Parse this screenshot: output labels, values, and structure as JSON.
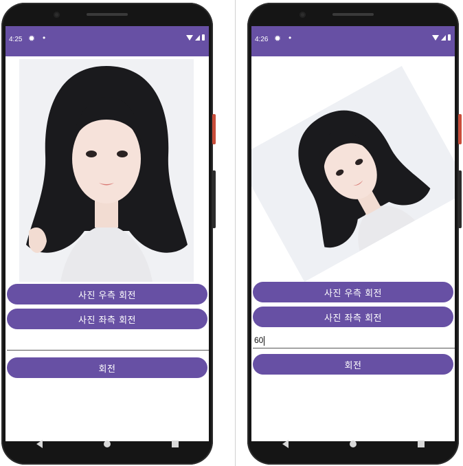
{
  "left_phone": {
    "status_time": "4:25",
    "buttons": {
      "rotate_right": "사진 우측 회전",
      "rotate_left": "사진 좌측 회전",
      "rotate": "회전"
    },
    "angle_input_value": ""
  },
  "right_phone": {
    "status_time": "4:26",
    "buttons": {
      "rotate_right": "사진 우측 회전",
      "rotate_left": "사진 좌측 회전",
      "rotate": "회전"
    },
    "angle_input_value": "60",
    "photo_rotation_degrees": -29
  },
  "colors": {
    "accent": "#6750a4",
    "phone_body": "#151515",
    "power_button": "#c84d3a"
  },
  "icons": [
    "gear-icon",
    "notification-dot-icon",
    "wifi-icon",
    "signal-icon",
    "battery-icon",
    "back-icon",
    "home-icon",
    "recent-apps-icon"
  ]
}
